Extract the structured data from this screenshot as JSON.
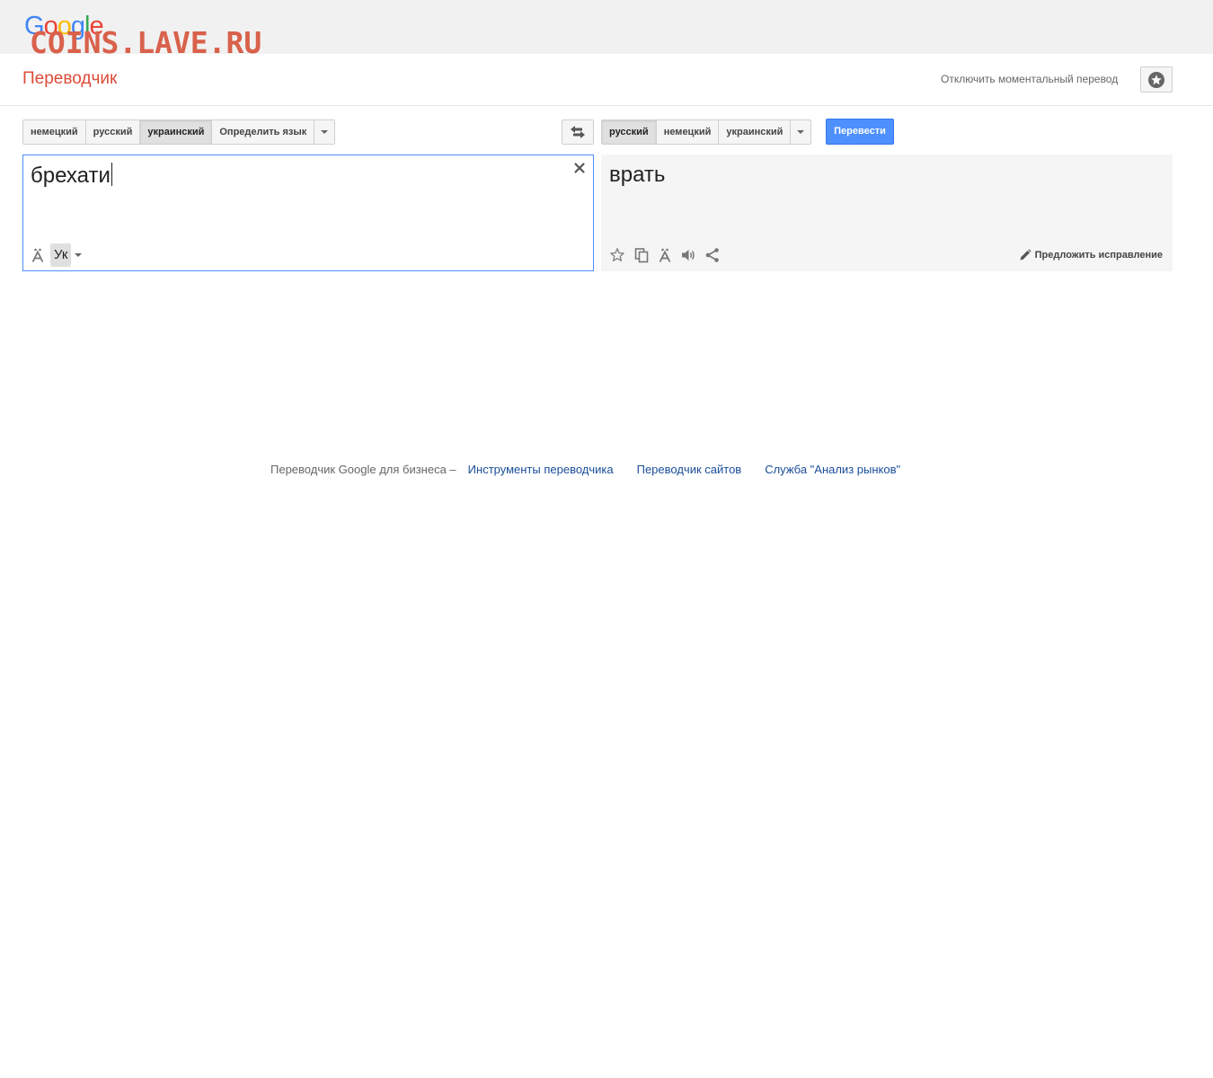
{
  "branding": {
    "logo_letters": [
      {
        "ch": "G",
        "color": "#4285f4"
      },
      {
        "ch": "o",
        "color": "#ea4335"
      },
      {
        "ch": "o",
        "color": "#fbbc05"
      },
      {
        "ch": "g",
        "color": "#4285f4"
      },
      {
        "ch": "l",
        "color": "#34a853"
      },
      {
        "ch": "e",
        "color": "#ea4335"
      }
    ],
    "watermark": "COINS.LAVE.RU"
  },
  "header": {
    "title": "Переводчик",
    "instant_toggle": "Отключить моментальный перевод"
  },
  "source": {
    "languages": [
      "немецкий",
      "русский",
      "украинский",
      "Определить язык"
    ],
    "selected": "украинский",
    "text": "брехати",
    "ime_label": "Ук"
  },
  "target": {
    "languages": [
      "русский",
      "немецкий",
      "украинский"
    ],
    "selected": "русский",
    "translate_label": "Перевести",
    "text": "врать",
    "suggest_label": "Предложить исправление"
  },
  "footer": {
    "lead": "Переводчик Google для бизнеса –",
    "links": [
      "Инструменты переводчика",
      "Переводчик сайтов",
      "Служба \"Анализ рынков\""
    ]
  },
  "colors": {
    "accent_red": "#dd4b39",
    "button_blue": "#4d90fe",
    "link_blue": "#1a4d98"
  },
  "icons": {
    "phrasebook": "star-circle-icon",
    "swap": "swap-arrows-icon",
    "clear": "close-icon",
    "virtual_keyboard": "umlaut-a-icon",
    "result_tools": [
      "star-icon",
      "copy-icon",
      "umlaut-a-icon",
      "speaker-icon",
      "share-icon"
    ],
    "suggest": "pencil-icon"
  }
}
